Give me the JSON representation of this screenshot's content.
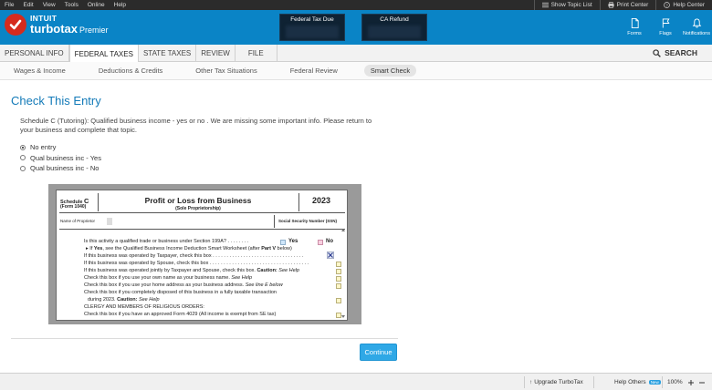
{
  "menubar": {
    "items": [
      "File",
      "Edit",
      "View",
      "Tools",
      "Online",
      "Help"
    ],
    "right": {
      "show_topic_list": "Show Topic List",
      "print_center": "Print Center",
      "help_center": "Help Center"
    }
  },
  "header": {
    "brand_top": "INTUIT",
    "brand_main": "turbotax",
    "brand_edition": "Premier",
    "federal_label": "Federal Tax Due",
    "state_label": "CA Refund",
    "icons": {
      "forms": "Forms",
      "flags": "Flags",
      "notifications": "Notifications"
    }
  },
  "tabs": {
    "personal_info": "PERSONAL INFO",
    "federal_taxes": "FEDERAL TAXES",
    "state_taxes": "STATE TAXES",
    "review": "REVIEW",
    "file": "FILE",
    "search": "SEARCH",
    "active": "FEDERAL TAXES"
  },
  "subnav": {
    "wages": "Wages & Income",
    "deductions": "Deductions & Credits",
    "other": "Other Tax Situations",
    "federal_review": "Federal Review",
    "smart_check": "Smart Check",
    "active": "Smart Check"
  },
  "page": {
    "title": "Check This Entry",
    "description": "Schedule C (Tutoring): Qualified business income - yes or no . We are missing some important info. Please return to your business and complete that topic.",
    "options": {
      "no_entry": "No entry",
      "yes": "Qual business inc - Yes",
      "no": "Qual business inc - No"
    },
    "selected_option": "No entry",
    "continue_label": "Continue"
  },
  "form": {
    "schedule_prefix": "Schedule ",
    "schedule_letter": "C",
    "form_number": "(Form 1040)",
    "title": "Profit or Loss from Business",
    "subtitle": "(Sole Proprietorship)",
    "year": "2023",
    "name_of_proprietor": "Name of Proprietor",
    "ssn_label": "Social Security Number (SSN)",
    "qbi_question": "Is this activity a qualified trade or business under Section 199A? . . . . . . . .",
    "yes_label": "Yes",
    "no_label": "No",
    "if_prefix": "▸ If ",
    "if_yes": "Yes",
    "if_middle": ", see the Qualified Business Income Deduction Smart Worksheet (after ",
    "part_v": "Part V",
    "if_end": " below)",
    "lines": {
      "taxpayer": "If this business was operated by Taxpayer, check this box . . . . . . . . . . . . . . . . . . . . . . . . . . . . . . . . .",
      "spouse": "If this business was operated by Spouse, check this box . . . . . . . . . . . . . . . . . . . . . . . . . . . . . . . . . . . .",
      "jointly_start": "If this business was operated jointly by Taxpayer and Spouse, check this box. ",
      "caution": "Caution:",
      "see_help": " See Help",
      "own_name_start": "Check this box if you use your own name as your business name. ",
      "own_name_help": "See Help",
      "home_address_start": "Check this box if you use your home address as your business address. ",
      "see_line_e": "See line E below",
      "disposed_1": "Check this box if you completely disposed of this business in a fully taxable transaction",
      "disposed_2_start": "during 2023. ",
      "disposed_caution": "Caution:",
      "disposed_help": " See Help",
      "clergy": "CLERGY AND MEMBERS OF RELIGIOUS ORDERS:",
      "form4029": "Check this box if you have an approved Form 4029 (All income is exempt from SE tax)"
    }
  },
  "footer": {
    "upgrade": "Upgrade TurboTax",
    "help_others": "Help Others",
    "new_badge": "New",
    "zoom": "100%"
  }
}
